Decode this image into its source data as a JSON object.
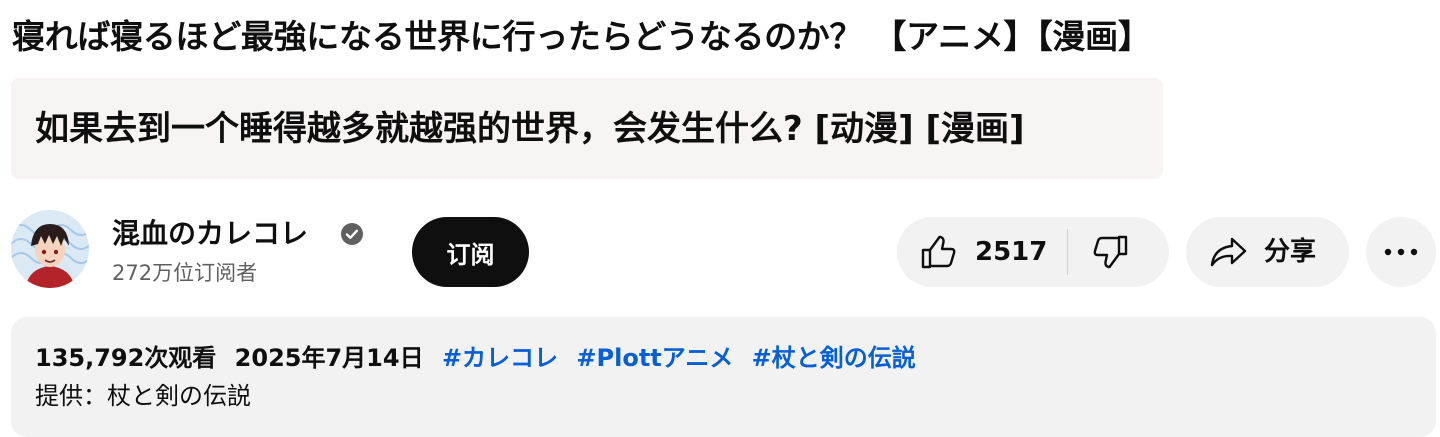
{
  "video": {
    "title": "寝れば寝るほど最強になる世界に行ったらどうなるのか？ 【アニメ】【漫画】",
    "translated_title": "如果去到一个睡得越多就越强的世界，会发生什么? [动漫] [漫画]"
  },
  "channel": {
    "name": "混血のカレコレ",
    "subscribers": "272万位订阅者",
    "verified_icon": "verified-check-icon",
    "subscribe_label": "订阅"
  },
  "actions": {
    "like_count": "2517",
    "share_label": "分享",
    "icons": {
      "like": "thumbs-up-icon",
      "dislike": "thumbs-down-icon",
      "share": "share-arrow-icon",
      "more": "more-horizontal-icon"
    }
  },
  "description": {
    "views": "135,792次观看",
    "date": "2025年7月14日",
    "hashtags": [
      "#カレコレ",
      "#Plottアニメ",
      "#杖と剣の伝説"
    ],
    "provider": "提供：杖と剣の伝説"
  },
  "colors": {
    "hashtag": "#065fd4",
    "subscribe_bg": "#0f0f0f",
    "button_bg": "#f2f2f2",
    "translation_bg": "#f8f4f3",
    "secondary_text": "#606060"
  }
}
